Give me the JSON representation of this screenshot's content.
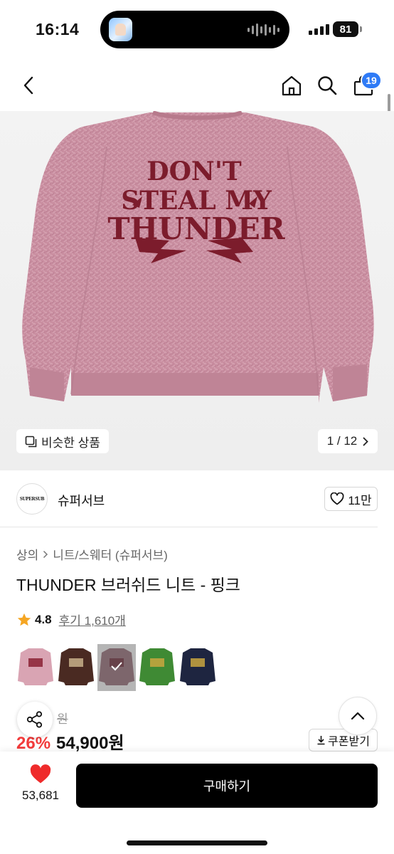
{
  "status": {
    "time": "16:14",
    "battery": "81"
  },
  "nav": {
    "cart_count": "19"
  },
  "hero": {
    "print_line1": "DON'T",
    "print_line2": "STEAL MY",
    "print_line3": "THUNDER",
    "similar_label": "비슷한 상품",
    "page_indicator": "1 / 12"
  },
  "brand": {
    "logo_text": "SUPERSUB",
    "name": "슈퍼서브",
    "likes": "11만"
  },
  "breadcrumb": {
    "level1": "상의",
    "level2": "니트/스웨터 (슈퍼서브)"
  },
  "product": {
    "title": "THUNDER 브러쉬드 니트 - 핑크",
    "rating": "4.8",
    "reviews": "후기 1,610개",
    "original_price": "원",
    "discount": "26%",
    "price": "54,900원",
    "coupon_label": "쿠폰받기"
  },
  "swatches": [
    {
      "color": "#d9a4b3",
      "accent": "#8a2234"
    },
    {
      "color": "#4a2a22",
      "accent": "#c8b08a"
    },
    {
      "color": "#9a6f7a",
      "accent": "#6b2230"
    },
    {
      "color": "#3f8a34",
      "accent": "#c9a640"
    },
    {
      "color": "#1e2540",
      "accent": "#c9a640"
    }
  ],
  "bottom": {
    "wish_count": "53,681",
    "buy_label": "구매하기"
  },
  "colors": {
    "accent_blue": "#2f7bf6",
    "discount_red": "#f23b3b",
    "heart_red": "#ef2b2b",
    "sweater_pink": "#c98ea0",
    "print_maroon": "#7c1c2c"
  }
}
